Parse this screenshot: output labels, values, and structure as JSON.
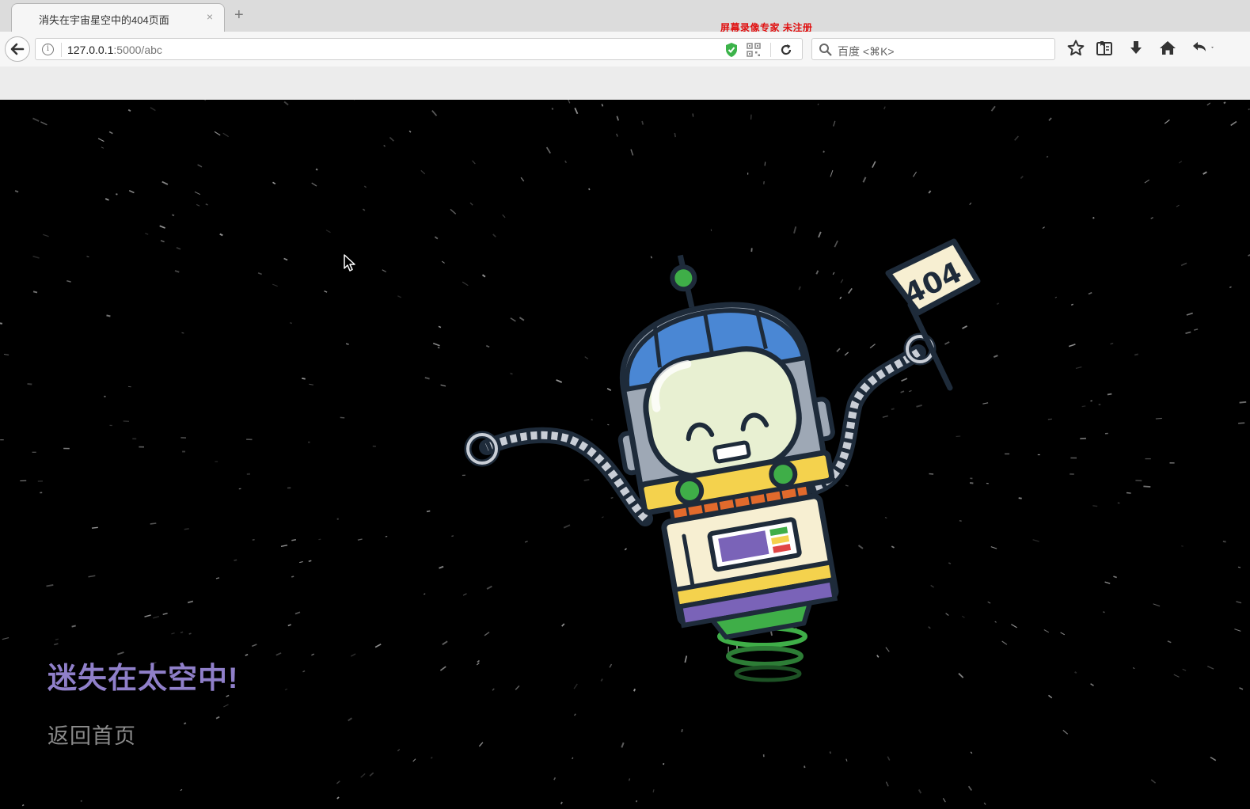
{
  "browser": {
    "tab_title": "消失在宇宙星空中的404页面",
    "tab_close": "×",
    "new_tab": "+",
    "url_host": "127.0.0.1",
    "url_rest": ":5000/abc",
    "search_placeholder": "百度 <⌘K>",
    "watermark": "屏幕录像专家  未注册"
  },
  "page": {
    "title": "迷失在太空中!",
    "home_link": "返回首页",
    "flag_text": "404"
  },
  "colors": {
    "title": "#8f7fc9",
    "link": "#8a8a8a",
    "background": "#000000",
    "watermark": "#e01010"
  },
  "icons": [
    "back-arrow-icon",
    "info-icon",
    "shield-icon",
    "qr-code-icon",
    "reload-icon",
    "search-icon",
    "bookmark-star-icon",
    "reading-list-icon",
    "download-icon",
    "home-icon",
    "undo-icon"
  ]
}
